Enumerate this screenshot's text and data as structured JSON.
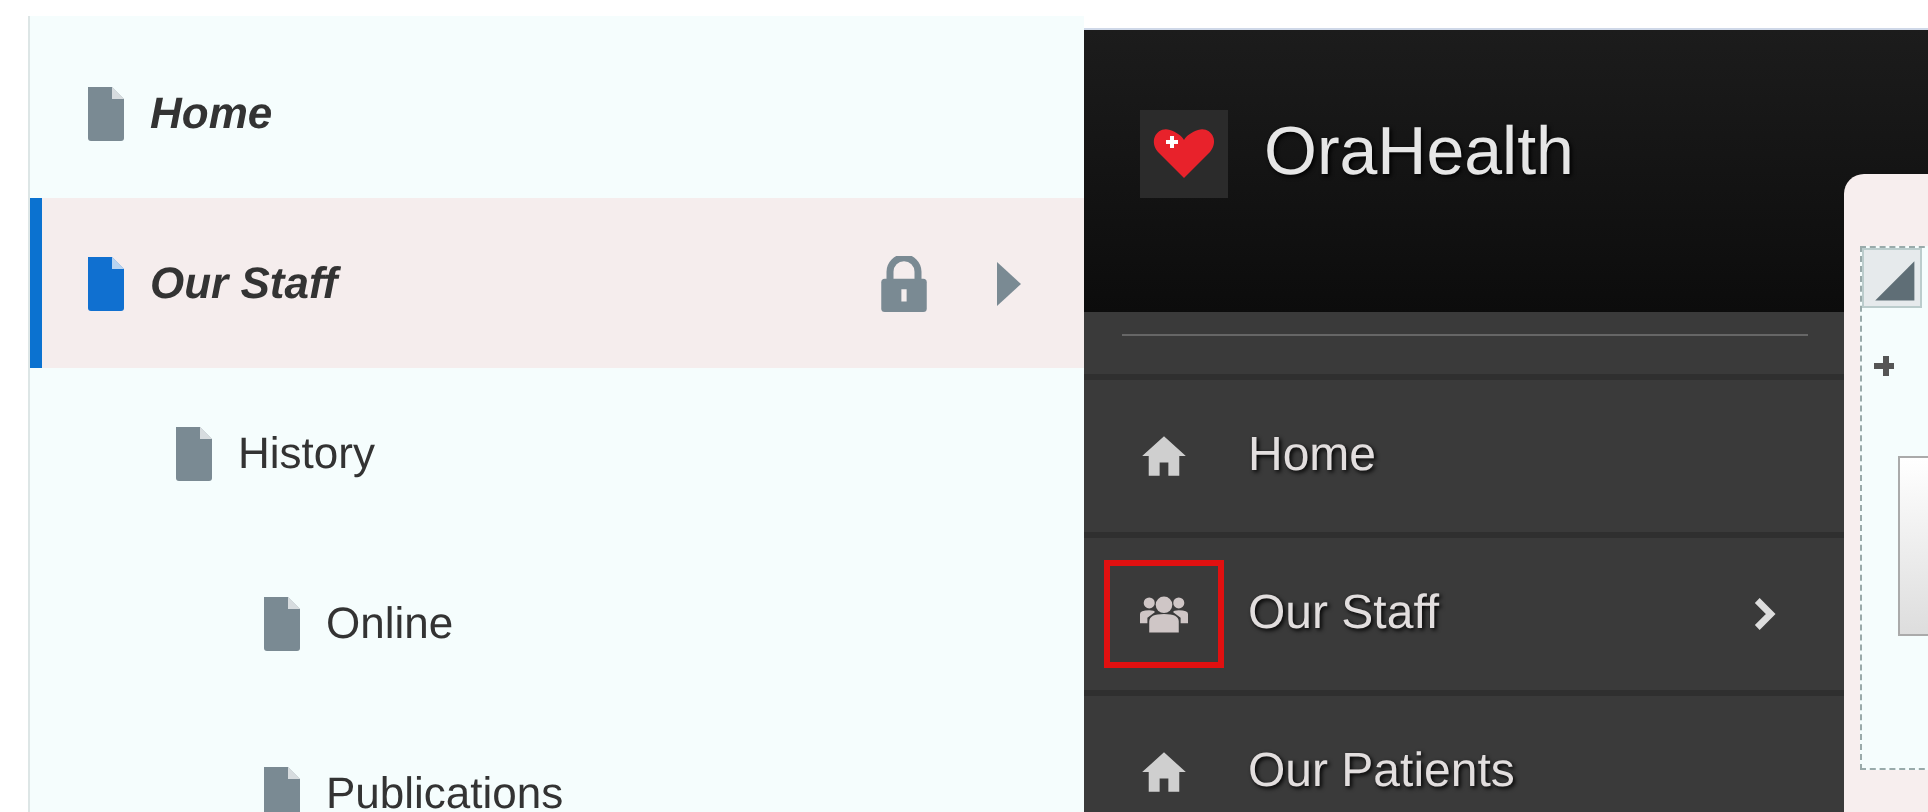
{
  "page_tree": {
    "items": [
      {
        "label": "Home",
        "selected": false,
        "locked": false,
        "has_arrow": false
      },
      {
        "label": "Our Staff",
        "selected": true,
        "locked": true,
        "has_arrow": true,
        "children": [
          {
            "label": "History",
            "selected": false,
            "locked": false,
            "has_arrow": false,
            "children": [
              {
                "label": "Online",
                "selected": false,
                "locked": false,
                "has_arrow": false
              },
              {
                "label": "Publications",
                "selected": false,
                "locked": false,
                "has_arrow": false
              }
            ]
          }
        ]
      }
    ]
  },
  "preview": {
    "brand": "OraHealth",
    "nav_items": [
      {
        "label": "Home",
        "kind": "home",
        "highlighted": false,
        "has_submenu": false
      },
      {
        "label": "Our Staff",
        "kind": "people",
        "highlighted": true,
        "has_submenu": true
      },
      {
        "label": "Our Patients",
        "kind": "home",
        "highlighted": false,
        "has_submenu": false
      }
    ]
  }
}
